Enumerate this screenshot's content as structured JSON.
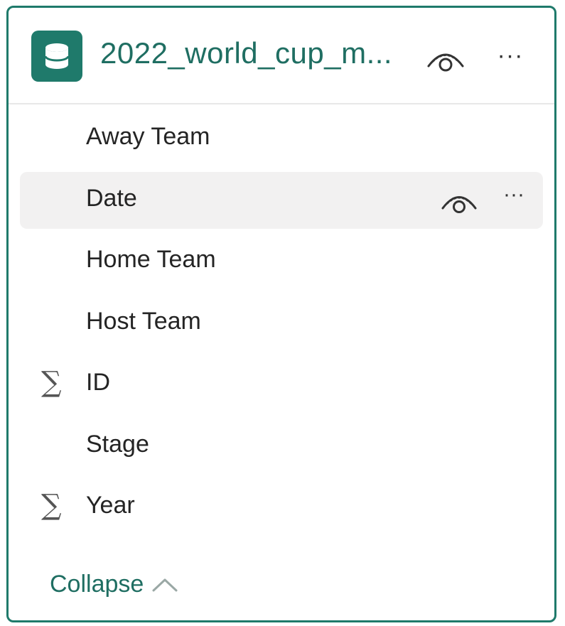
{
  "header": {
    "title": "2022_world_cup_m...",
    "icons": [
      "database-icon",
      "eye-icon",
      "more-icon"
    ]
  },
  "fields": [
    {
      "label": "Away Team",
      "type": "text"
    },
    {
      "label": "Date",
      "type": "text",
      "selected": true
    },
    {
      "label": "Home Team",
      "type": "text"
    },
    {
      "label": "Host Team",
      "type": "text"
    },
    {
      "label": "ID",
      "type": "sum"
    },
    {
      "label": "Stage",
      "type": "text"
    },
    {
      "label": "Year",
      "type": "sum"
    }
  ],
  "more_glyph": "···",
  "sigma_glyph": "∑",
  "footer": {
    "collapse_label": "Collapse"
  },
  "colors": {
    "accent": "#1f7a6b",
    "selected_row": "#f2f1f1"
  }
}
